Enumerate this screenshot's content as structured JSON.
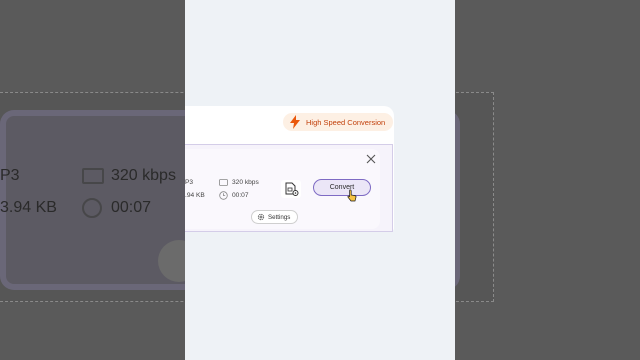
{
  "background": {
    "format_fragment": "P3",
    "size_fragment": "3.94 KB",
    "bitrate": "320 kbps",
    "duration": "00:07"
  },
  "toolbar": {
    "high_speed_label": "High Speed Conversion",
    "accent_color": "#ea580c"
  },
  "file_row": {
    "format_fragment": "P3",
    "size_fragment": ".94 KB",
    "bitrate": "320 kbps",
    "duration": "00:07"
  },
  "actions": {
    "convert_label": "Convert",
    "settings_label": "Settings"
  },
  "icons": [
    "lightning-icon",
    "close-icon",
    "bitrate-icon",
    "clock-icon",
    "file-settings-icon",
    "gear-icon",
    "cursor-icon"
  ]
}
